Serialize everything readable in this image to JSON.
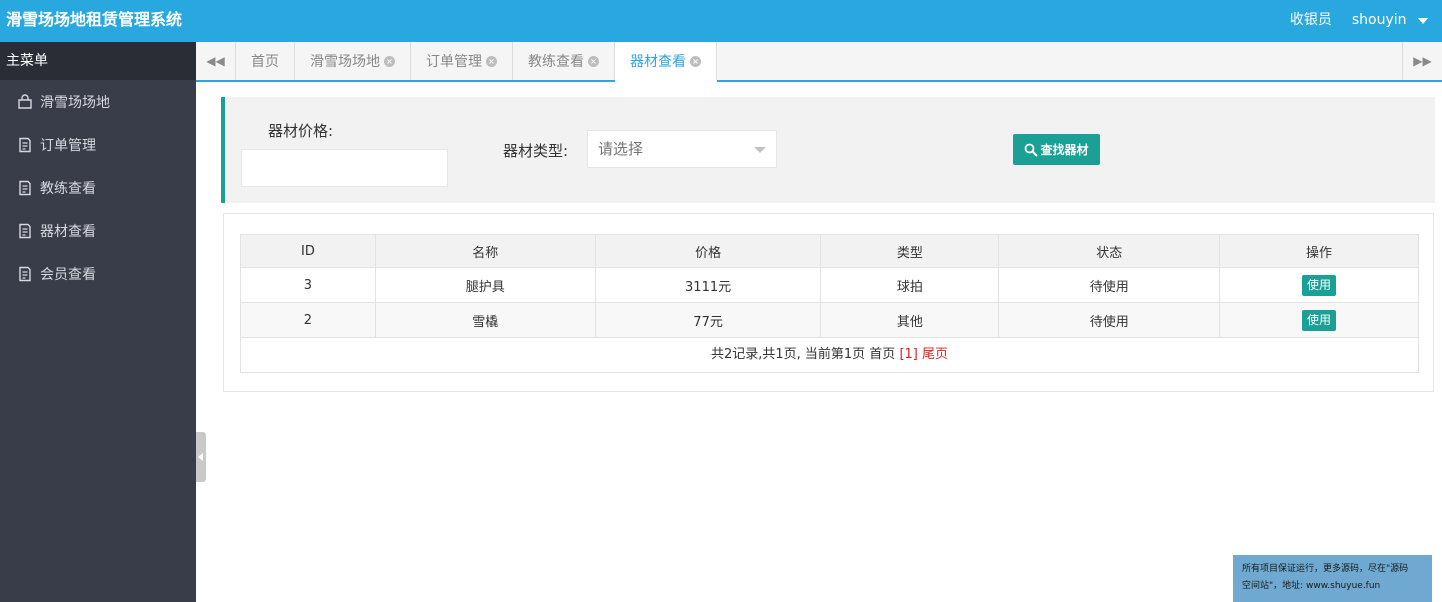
{
  "header": {
    "app_title": "滑雪场场地租赁管理系统",
    "role": "收银员",
    "username": "shouyin"
  },
  "sidebar": {
    "title": "主菜单",
    "items": [
      {
        "label": "滑雪场场地",
        "icon": "bag-icon"
      },
      {
        "label": "订单管理",
        "icon": "document-icon"
      },
      {
        "label": "教练查看",
        "icon": "document-icon"
      },
      {
        "label": "器材查看",
        "icon": "document-icon"
      },
      {
        "label": "会员查看",
        "icon": "document-icon"
      }
    ]
  },
  "tabs": [
    {
      "label": "首页",
      "closable": false,
      "active": false
    },
    {
      "label": "滑雪场场地",
      "closable": true,
      "active": false
    },
    {
      "label": "订单管理",
      "closable": true,
      "active": false
    },
    {
      "label": "教练查看",
      "closable": true,
      "active": false
    },
    {
      "label": "器材查看",
      "closable": true,
      "active": true
    }
  ],
  "search": {
    "price_label": "器材价格:",
    "price_value": "",
    "type_label": "器材类型:",
    "type_placeholder": "请选择",
    "button_label": "查找器材"
  },
  "table": {
    "headers": [
      "ID",
      "名称",
      "价格",
      "类型",
      "状态",
      "操作"
    ],
    "rows": [
      {
        "id": "3",
        "name": "腿护具",
        "price": "3111元",
        "type": "球拍",
        "status": "待使用",
        "action": "使用"
      },
      {
        "id": "2",
        "name": "雪橇",
        "price": "77元",
        "type": "其他",
        "status": "待使用",
        "action": "使用"
      }
    ],
    "pager": {
      "summary": "共2记录,共1页, 当前第1页 首页",
      "current": "[1]",
      "last": "尾页"
    }
  },
  "watermark": {
    "line1": "所有项目保证运行，更多源码，尽在\"源码",
    "line2": "空间站\"，地址: www.shuyue.fun"
  },
  "colors": {
    "header_bg": "#29a8e0",
    "sidebar_bg": "#393d49",
    "accent_green": "#1aa094"
  }
}
